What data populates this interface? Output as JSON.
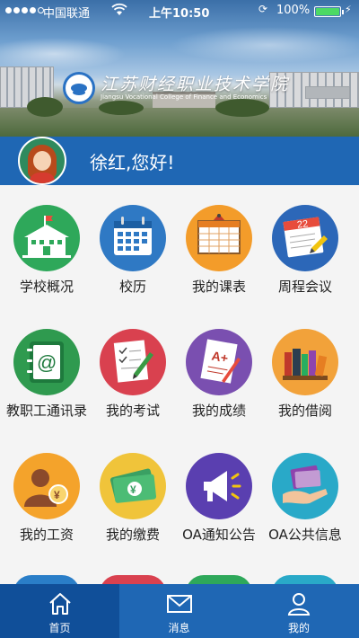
{
  "status_bar": {
    "carrier": "中国联通",
    "time": "上午10:50",
    "battery_percent": "100%",
    "battery_level": 1.0,
    "battery_color": "#4cd964"
  },
  "header": {
    "school_name_cn": "江苏财经职业技术学院",
    "school_name_en": "Jiangsu Vocational College of Finance and Economics"
  },
  "user": {
    "greeting": "徐红,您好!"
  },
  "grid": {
    "items": [
      {
        "label": "学校概况",
        "icon": "school-building-icon",
        "color": "#2ea85a"
      },
      {
        "label": "校历",
        "icon": "calendar-icon",
        "color": "#2f79c4"
      },
      {
        "label": "我的课表",
        "icon": "timetable-icon",
        "color": "#f39c2a"
      },
      {
        "label": "周程会议",
        "icon": "meeting-calendar-icon",
        "color": "#2c67b8"
      },
      {
        "label": "教职工通讯录",
        "icon": "address-book-icon",
        "color": "#2f9a4f"
      },
      {
        "label": "我的考试",
        "icon": "exam-paper-icon",
        "color": "#d9414f"
      },
      {
        "label": "我的成绩",
        "icon": "grade-icon",
        "color": "#7a4fb0"
      },
      {
        "label": "我的借阅",
        "icon": "bookshelf-icon",
        "color": "#f2a23a"
      },
      {
        "label": "我的工资",
        "icon": "salary-icon",
        "color": "#f4a32b"
      },
      {
        "label": "我的缴费",
        "icon": "payment-icon",
        "color": "#f0c43a"
      },
      {
        "label": "OA通知公告",
        "icon": "announcement-icon",
        "color": "#5a3fb0"
      },
      {
        "label": "OA公共信息",
        "icon": "public-info-icon",
        "color": "#29a9c8"
      }
    ],
    "peek_colors": [
      "#2a7ec8",
      "#d9414f",
      "#2ea85a",
      "#29a9c8"
    ]
  },
  "tabbar": {
    "tabs": [
      {
        "label": "首页",
        "icon": "home-icon",
        "active": true
      },
      {
        "label": "消息",
        "icon": "message-icon",
        "active": false
      },
      {
        "label": "我的",
        "icon": "profile-icon",
        "active": false
      }
    ]
  }
}
